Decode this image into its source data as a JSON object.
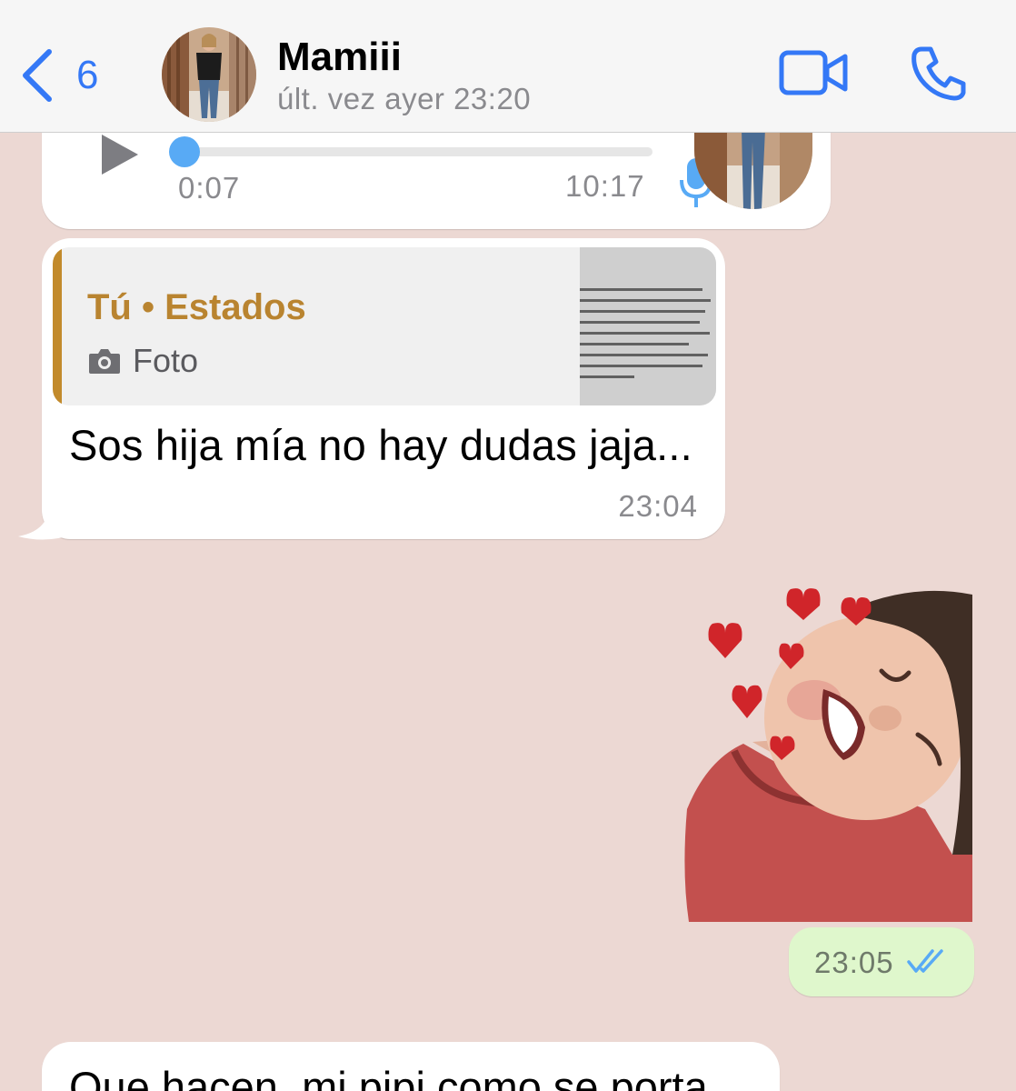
{
  "header": {
    "back_count": "6",
    "contact_name": "Mamiii",
    "status": "últ. vez ayer 23:20"
  },
  "audio_message": {
    "duration": "0:07",
    "time": "10:17",
    "progress": 0
  },
  "reply_message": {
    "quote_title": "Tú • Estados",
    "quote_type": "Foto",
    "text": "Sos hija mía no hay dudas jaja...",
    "time": "23:04"
  },
  "sticker_message": {
    "time": "23:05",
    "status": "read"
  },
  "last_message": {
    "text": "Que hacen, mi pipi como se porta"
  },
  "colors": {
    "accent": "#3478f6",
    "chat_background": "#ecd8d3",
    "outgoing_bubble": "#dff7cc",
    "quote_accent": "#c28a2b",
    "audio_progress": "#58aaf5"
  },
  "icons": [
    "chevron-left-icon",
    "video-call-icon",
    "phone-icon",
    "play-icon",
    "microphone-icon",
    "camera-icon",
    "double-check-icon",
    "heart-icon"
  ]
}
